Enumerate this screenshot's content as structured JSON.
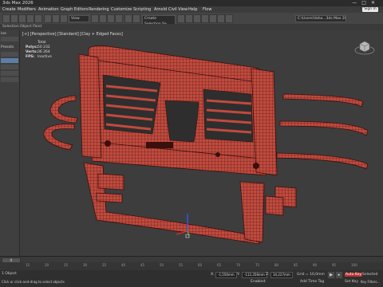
{
  "window": {
    "title": "3ds Max 2026",
    "controls": [
      "—",
      "□",
      "✕"
    ]
  },
  "menu": [
    "Create",
    "Modifiers",
    "Animation",
    "Graph Editors",
    "Rendering",
    "Customize",
    "Scripting",
    "Arnold",
    "Civil View",
    "Help",
    "Flow"
  ],
  "sign_in_label": "Sign In",
  "toolbar": {
    "view_dropdown": "View",
    "selection_set": "Create Selection Se",
    "workspace": "C:\\Users\\Vaho...3ds Max 2026"
  },
  "ribbon": [
    "Selection",
    "Object Paint"
  ],
  "left_panel": {
    "labels": [
      "ine",
      "Presets"
    ]
  },
  "viewport": {
    "label": "[+] [Perspective] [Standard] [Clay + Edged Faces]",
    "stats": [
      {
        "key": "",
        "value": "Total"
      },
      {
        "key": "Polys:",
        "value": "50 232"
      },
      {
        "key": "Verts:",
        "value": "36 264"
      },
      {
        "key": "FPS:",
        "value": "Inactive"
      }
    ]
  },
  "ruler_ticks": [
    "15",
    "20",
    "25",
    "30",
    "35",
    "40",
    "45",
    "50",
    "55",
    "60",
    "65",
    "70",
    "75",
    "80",
    "85",
    "90",
    "95",
    "100"
  ],
  "status": {
    "selected": "1 Object",
    "prompt": "Click or click-and-drag to select objects",
    "x_label": "X:",
    "y_label": "Y:",
    "z_label": "Z:",
    "x": "-1,556mm",
    "y": "-112,356mm",
    "z": "34,227mm",
    "grid_label": "Grid = 10,0mm",
    "autokey": "Auto Key",
    "selected_dropdown": "Selected",
    "set_key": "Set Key",
    "key_filters": "Key Filters...",
    "add_time_tag": "Add Time Tag",
    "enabled": "Enabled:",
    "frame": "0"
  },
  "colors": {
    "model_fill": "#c04a3e",
    "wire": "#3a0f0c",
    "viewport_bg": "#3d3d3d",
    "accent": "#5d7fa6"
  }
}
